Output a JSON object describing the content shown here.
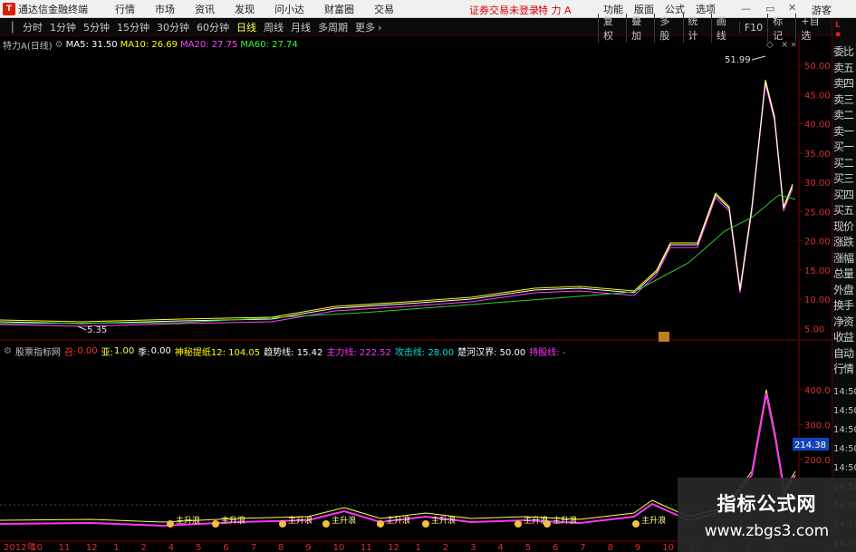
{
  "titlebar": {
    "app_title": "通达信金融终端",
    "menu": [
      "行情",
      "市场",
      "资讯",
      "发现",
      "问小达",
      "财富圈",
      "交易"
    ],
    "login_status": "证券交易未登录",
    "stock_name": "特 力 A",
    "right_items": [
      "功能",
      "版面",
      "公式",
      "选项"
    ],
    "guest": "游客"
  },
  "periodbar": {
    "periods": [
      "分时",
      "1分钟",
      "5分钟",
      "15分钟",
      "30分钟",
      "60分钟",
      "日线",
      "周线",
      "月线",
      "多周期",
      "更多"
    ],
    "active_period": "日线",
    "tools": [
      "复权",
      "叠加",
      "多股",
      "统计",
      "画线",
      "F10",
      "标记",
      "+自选"
    ]
  },
  "main_info": {
    "name": "特力A(日线)",
    "ma5": "MA5: 31.50",
    "ma10": "MA10: 26.69",
    "ma20": "MA20: 27.75",
    "ma60": "MA60: 27.74",
    "colors": {
      "ma5": "#ffffff",
      "ma10": "#ffff00",
      "ma20": "#ff44ff",
      "ma60": "#00ff00"
    }
  },
  "price_axis": {
    "ticks": [
      "50.00",
      "45.00",
      "40.00",
      "35.00",
      "30.00",
      "25.00",
      "20.00",
      "15.00",
      "10.00",
      "5.00"
    ],
    "high_label": "51.99",
    "low_label": "5.35"
  },
  "indicator_info": {
    "name": "股票指标网",
    "v1_label": "召:",
    "v1": "0.00",
    "v2_label": "亚:",
    "v2": "1.00",
    "v3_label": "季:",
    "v3": "0.00",
    "v4": "神秘提纸12: 104.05",
    "v5": "趋势线: 15.42",
    "v6": "主力线: 222.52",
    "v7": "攻击线: 28.00",
    "v8": "楚河汉界: 50.00",
    "v9": "持股线: -"
  },
  "indicator_axis": {
    "ticks": [
      "400.0",
      "300.0",
      "200.0"
    ],
    "current": "214.38"
  },
  "signal_label": "主升浪",
  "date_axis": [
    "2012年",
    "10",
    "11",
    "12",
    "1",
    "2",
    "4",
    "5",
    "6",
    "7",
    "8",
    "9",
    "10",
    "11",
    "12",
    "1",
    "2",
    "3",
    "4",
    "5",
    "6",
    "7",
    "8",
    "9",
    "10",
    "11",
    "12",
    "1",
    "2"
  ],
  "sidestrip": {
    "items": [
      "委比",
      "卖五",
      "卖四",
      "卖三",
      "卖二",
      "卖一",
      "买一",
      "买二",
      "买三",
      "买四",
      "买五",
      "现价",
      "涨跌",
      "涨幅",
      "总量",
      "外盘",
      "换手",
      "净资",
      "收益",
      "自动",
      "行情"
    ],
    "times": [
      "14:50",
      "14:50",
      "14:50",
      "14:50",
      "14:50",
      "14:50",
      "14:50",
      "14:50",
      "14:50"
    ]
  },
  "watermark": {
    "line1": "指标公式网",
    "line2": "www.zbgs3.com"
  }
}
